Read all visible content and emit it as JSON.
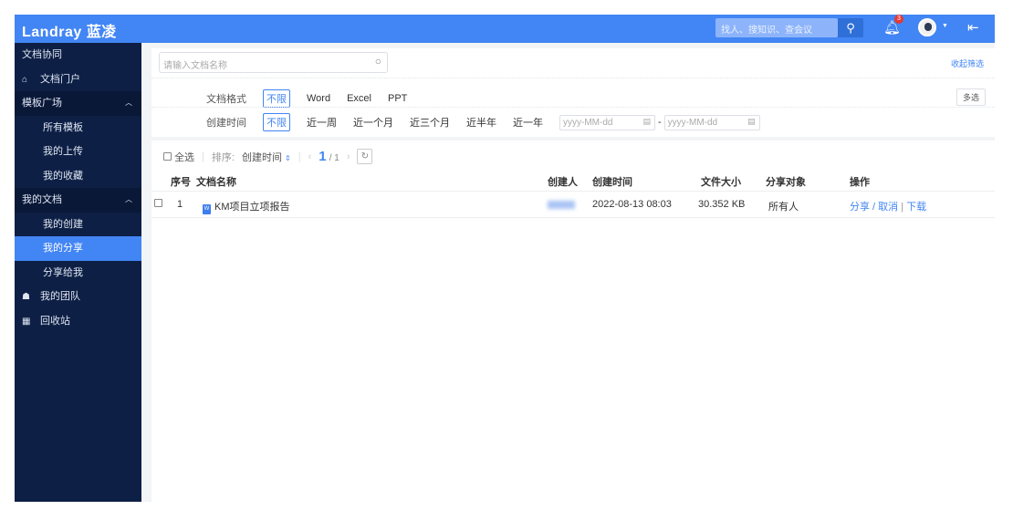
{
  "header": {
    "logo": "Landray 蓝凌",
    "search_placeholder": "找人、搜知识、查会议",
    "notification_count": "3"
  },
  "sidebar": {
    "title": "文档协同",
    "items": [
      {
        "label": "文档门户"
      },
      {
        "label": "模板广场"
      },
      {
        "label": "所有模板"
      },
      {
        "label": "我的上传"
      },
      {
        "label": "我的收藏"
      },
      {
        "label": "我的文档"
      },
      {
        "label": "我的创建"
      },
      {
        "label": "我的分享"
      },
      {
        "label": "分享给我"
      },
      {
        "label": "我的团队"
      },
      {
        "label": "回收站"
      }
    ]
  },
  "filter": {
    "search_placeholder": "请输入文档名称",
    "collapse": "收起筛选",
    "multi_select": "多选",
    "format_label": "文档格式",
    "format_options": [
      "不限",
      "Word",
      "Excel",
      "PPT"
    ],
    "time_label": "创建时间",
    "time_options": [
      "不限",
      "近一周",
      "近一个月",
      "近三个月",
      "近半年",
      "近一年"
    ],
    "date_placeholder": "yyyy-MM-dd"
  },
  "toolbar": {
    "select_all": "全选",
    "sort_label": "排序:",
    "sort_value": "创建时间",
    "page_current": "1",
    "page_total": "/ 1"
  },
  "table": {
    "headers": [
      "序号",
      "文档名称",
      "创建人",
      "创建时间",
      "文件大小",
      "分享对象",
      "操作"
    ],
    "rows": [
      {
        "index": "1",
        "name": "KM项目立项报告",
        "created": "2022-08-13 08:03",
        "size": "30.352 KB",
        "target": "所有人",
        "share": "分享",
        "cancel": "取消",
        "download": "下载"
      }
    ]
  }
}
